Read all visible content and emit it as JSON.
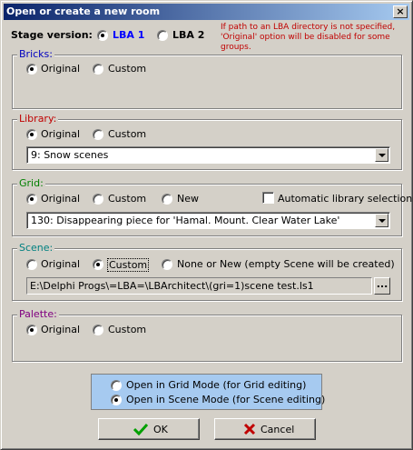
{
  "window": {
    "title": "Open or create a new room",
    "close_label": "×"
  },
  "stage": {
    "label": "Stage version:",
    "options": [
      "LBA 1",
      "LBA 2"
    ],
    "selected": "LBA 1",
    "note": "If path to an LBA directory is not specified, 'Original' option will be disabled for some groups."
  },
  "bricks": {
    "label": "Bricks:",
    "options": [
      "Original",
      "Custom"
    ],
    "selected": "Original"
  },
  "library": {
    "label": "Library:",
    "options": [
      "Original",
      "Custom"
    ],
    "selected": "Original",
    "combo_value": "9: Snow scenes"
  },
  "grid": {
    "label": "Grid:",
    "options": [
      "Original",
      "Custom",
      "New"
    ],
    "selected": "Original",
    "auto_library_label": "Automatic library selection",
    "auto_library_checked": false,
    "combo_value": "130: Disappearing piece for 'Hamal. Mount. Clear Water Lake'"
  },
  "scene": {
    "label": "Scene:",
    "options": [
      "Original",
      "Custom",
      "None or New (empty Scene will be created)"
    ],
    "selected": "Custom",
    "path_value": "E:\\Delphi Progs\\=LBA=\\LBArchitect\\(gri=1)scene test.ls1",
    "browse_label": "..."
  },
  "palette": {
    "label": "Palette:",
    "options": [
      "Original",
      "Custom"
    ],
    "selected": "Original"
  },
  "mode": {
    "options": [
      "Open in Grid Mode (for Grid editing)",
      "Open in Scene Mode (for Scene editing)"
    ],
    "selected": "Open in Scene Mode (for Scene editing)"
  },
  "buttons": {
    "ok": "OK",
    "cancel": "Cancel"
  },
  "colors": {
    "bricks_label": "#0000c0",
    "library_label": "#c00000",
    "grid_label": "#008000",
    "scene_label": "#008080",
    "palette_label": "#800080",
    "note_text": "#c00000",
    "stage_selected": "#0000ff",
    "ok_check": "#00a000",
    "cancel_x": "#c00000"
  }
}
